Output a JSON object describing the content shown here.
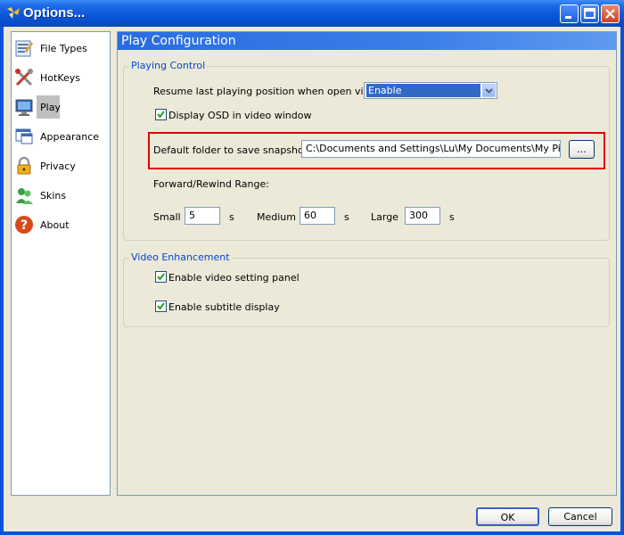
{
  "window": {
    "title": "Options..."
  },
  "sidebar": {
    "items": [
      {
        "label": "File Types",
        "icon": "file-types-icon"
      },
      {
        "label": "HotKeys",
        "icon": "hotkeys-icon"
      },
      {
        "label": "Play",
        "icon": "monitor-icon",
        "selected": true
      },
      {
        "label": "Appearance",
        "icon": "appearance-icon"
      },
      {
        "label": "Privacy",
        "icon": "lock-icon"
      },
      {
        "label": "Skins",
        "icon": "skins-icon"
      },
      {
        "label": "About",
        "icon": "help-icon"
      }
    ]
  },
  "panel": {
    "title": "Play Configuration",
    "playing_control": {
      "legend": "Playing Control",
      "resume_label": "Resume last playing position when open video:",
      "resume_value": "Enable",
      "osd_label": "Display OSD in video window",
      "osd_checked": true,
      "snapshot_label": "Default folder to save snapshot:",
      "snapshot_value": "C:\\Documents and Settings\\Lu\\My Documents\\My Pictures",
      "browse_label": "...",
      "range_label": "Forward/Rewind Range:",
      "small_label": "Small",
      "small_value": "5",
      "small_unit": "s",
      "medium_label": "Medium",
      "medium_value": "60",
      "medium_unit": "s",
      "large_label": "Large",
      "large_value": "300",
      "large_unit": "s"
    },
    "video_enhancement": {
      "legend": "Video Enhancement",
      "panel_label": "Enable video setting panel",
      "panel_checked": true,
      "subtitle_label": "Enable subtitle display",
      "subtitle_checked": true
    }
  },
  "footer": {
    "ok_label": "OK",
    "cancel_label": "Cancel"
  },
  "colors": {
    "titlebar": "#0a55d8",
    "panel_header": "#2a6ce0",
    "highlight": "#e00000",
    "legend": "#0046d5"
  }
}
